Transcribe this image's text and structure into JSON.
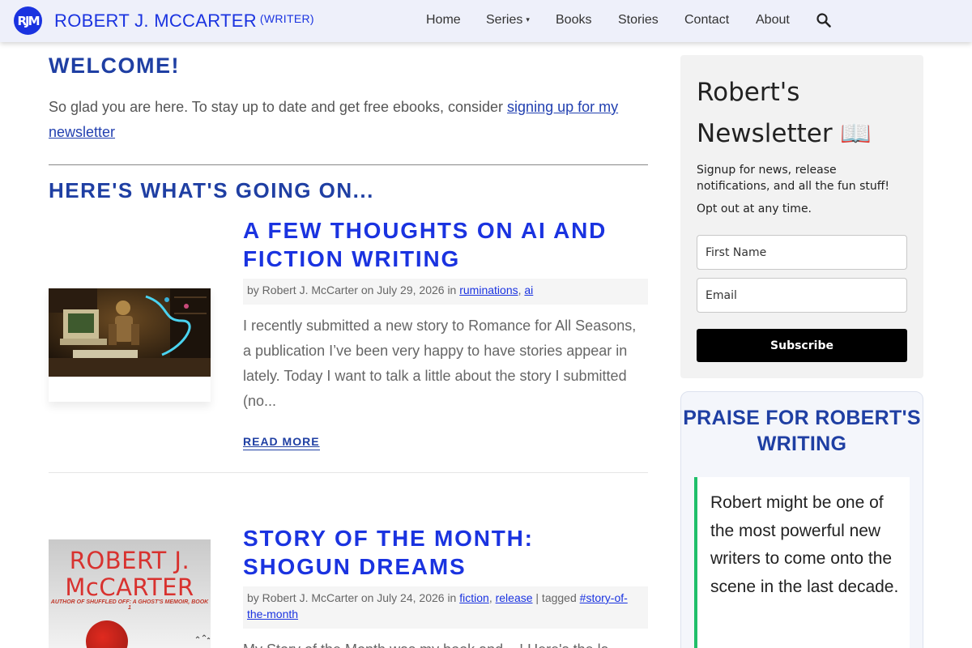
{
  "header": {
    "logo_text": "RJM",
    "site_title": "ROBERT J. MCCARTER",
    "site_tagline": "(WRITER)",
    "nav": [
      {
        "label": "Home"
      },
      {
        "label": "Series",
        "has_dropdown": true
      },
      {
        "label": "Books"
      },
      {
        "label": "Stories"
      },
      {
        "label": "Contact"
      },
      {
        "label": "About"
      }
    ],
    "search_icon": "search-icon",
    "caret_glyph": "▾"
  },
  "welcome": {
    "title": "WELCOME!",
    "text_before_link": "So glad you are here. To stay up to date and get free ebooks, consider ",
    "link_text": "signing up for my newsletter"
  },
  "section_title": "HERE'S WHAT'S GOING ON...",
  "posts": [
    {
      "title": "A Few Thoughts on AI and Fiction Writing",
      "meta_prefix": "by Robert J. McCarter on July 29, 2026 in ",
      "categories": [
        "ruminations",
        "ai"
      ],
      "excerpt": "I recently submitted a new story to Romance for All Seasons, a publication I’ve been very happy to have stories appear in lately. Today I want to talk a little about the story I submitted (no...",
      "read_more": "READ MORE"
    },
    {
      "title": "Story of the Month: Shogun Dreams",
      "meta_prefix": "by Robert J. McCarter on July 24, 2026 in ",
      "categories": [
        "fiction",
        "release"
      ],
      "tag_separator": " | tagged ",
      "tags": [
        "#story-of-the-month"
      ],
      "excerpt": "My Story of the Month was my book and ...! Here's the la...",
      "cover_author": "ROBERT J. McCARTER",
      "cover_subtitle": "AUTHOR OF SHUFFLED OFF: A GHOST'S MEMOIR, BOOK 1"
    }
  ],
  "newsletter": {
    "title": "Robert's Newsletter 📖",
    "description": "Signup for news, release notifications, and all the fun stuff!",
    "opt_out": "Opt out at any time.",
    "first_name_placeholder": "First Name",
    "email_placeholder": "Email",
    "subscribe_label": "Subscribe"
  },
  "praise": {
    "title": "PRAISE FOR ROBERT'S WRITING",
    "quote": "Robert might be one of the most powerful new writers to come onto the scene in the last decade."
  },
  "colors": {
    "brand_blue": "#1a33e0",
    "heading_blue": "#1f3fa3",
    "quote_accent": "#1fbf6a",
    "header_bg": "#eef0fa"
  }
}
